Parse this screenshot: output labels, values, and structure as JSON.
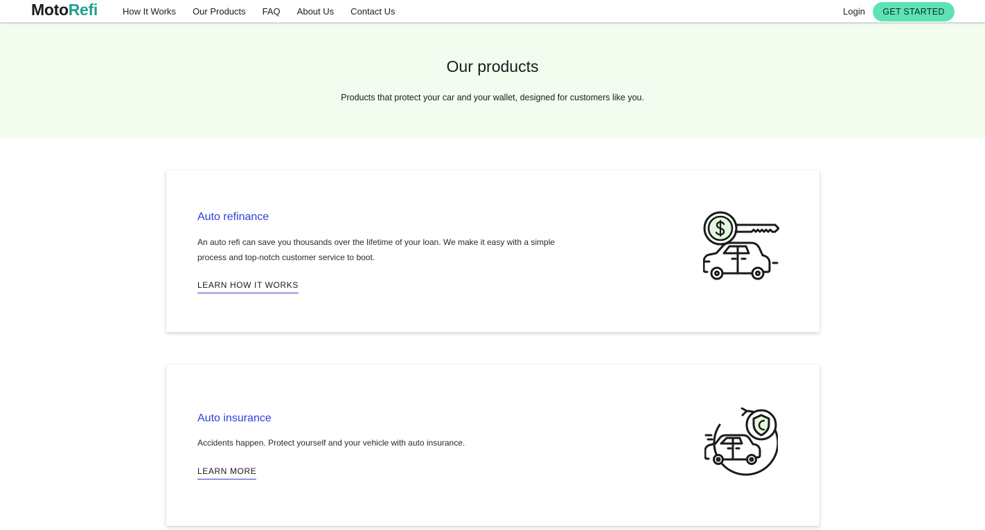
{
  "header": {
    "logo_part1": "Moto",
    "logo_part2": "Refi",
    "nav": [
      "How It Works",
      "Our Products",
      "FAQ",
      "About Us",
      "Contact Us"
    ],
    "login": "Login",
    "cta": "GET STARTED"
  },
  "hero": {
    "title": "Our products",
    "subtitle": "Products that protect your car and your wallet, designed for customers like you."
  },
  "products": [
    {
      "title": "Auto refinance",
      "description": "An auto refi can save you thousands over the lifetime of your loan. We make it easy with a simple process and top-notch customer service to boot.",
      "link": "LEARN HOW IT WORKS",
      "icon": "car-key-dollar-icon"
    },
    {
      "title": "Auto insurance",
      "description": "Accidents happen. Protect yourself and your vehicle with auto insurance.",
      "link": "LEARN MORE",
      "icon": "car-shield-icon"
    }
  ],
  "colors": {
    "brand_dark": "#1b1b1b",
    "brand_accent": "#1fa08c",
    "cta_bg": "#5de2b4",
    "hero_bg": "#f2fdf0",
    "product_title": "#2b3fd6",
    "illustration_fill": "#e4f8df"
  }
}
